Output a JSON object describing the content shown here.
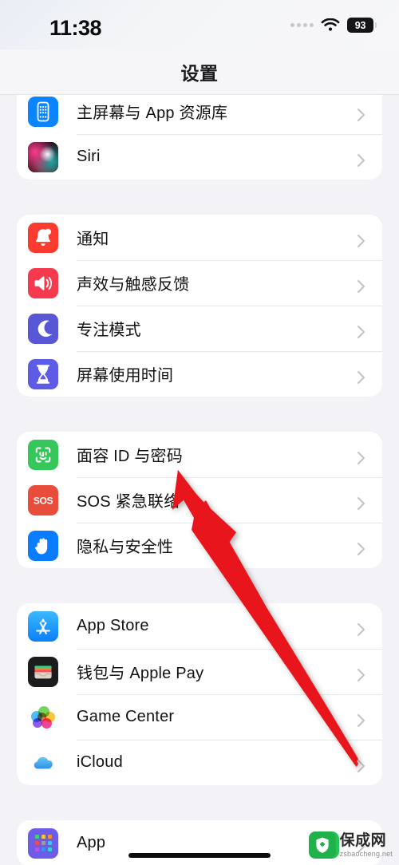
{
  "status_bar": {
    "time": "11:38",
    "signal_icon": "signal-dots-icon",
    "wifi_icon": "wifi-icon",
    "battery_level": "93",
    "battery_icon": "battery-icon"
  },
  "nav": {
    "title": "设置"
  },
  "colors": {
    "page_background": "#f2f2f7",
    "card_background": "#ffffff",
    "separator": "#e7e7ea",
    "chevron": "#c2c2c7",
    "label": "#121214",
    "arrow": "#e8161a",
    "battery_pill": "#151517"
  },
  "groups": [
    {
      "id": "group-personalization",
      "clipped_top": true,
      "rows": [
        {
          "id": "home-screen-app-library",
          "label": "主屏幕与 App 资源库",
          "icon": "home-screen-icon",
          "chevron": "chevron-right-icon"
        },
        {
          "id": "siri",
          "label": "Siri",
          "icon": "siri-icon",
          "chevron": "chevron-right-icon"
        }
      ]
    },
    {
      "id": "group-alerts",
      "clipped_top": false,
      "rows": [
        {
          "id": "notifications",
          "label": "通知",
          "icon": "bell-icon",
          "chevron": "chevron-right-icon"
        },
        {
          "id": "sounds-haptics",
          "label": "声效与触感反馈",
          "icon": "speaker-icon",
          "chevron": "chevron-right-icon"
        },
        {
          "id": "focus",
          "label": "专注模式",
          "icon": "moon-icon",
          "chevron": "chevron-right-icon"
        },
        {
          "id": "screen-time",
          "label": "屏幕使用时间",
          "icon": "hourglass-icon",
          "chevron": "chevron-right-icon"
        }
      ]
    },
    {
      "id": "group-security",
      "clipped_top": false,
      "rows": [
        {
          "id": "face-id-passcode",
          "label": "面容 ID 与密码",
          "icon": "face-id-icon",
          "chevron": "chevron-right-icon"
        },
        {
          "id": "emergency-sos",
          "label": "SOS 紧急联络",
          "icon": "sos-icon",
          "chevron": "chevron-right-icon"
        },
        {
          "id": "privacy-security",
          "label": "隐私与安全性",
          "icon": "hand-icon",
          "chevron": "chevron-right-icon"
        }
      ]
    },
    {
      "id": "group-services",
      "clipped_top": false,
      "rows": [
        {
          "id": "app-store",
          "label": "App Store",
          "icon": "app-store-icon",
          "chevron": "chevron-right-icon"
        },
        {
          "id": "wallet-apple-pay",
          "label": "钱包与 Apple Pay",
          "icon": "wallet-icon",
          "chevron": "chevron-right-icon"
        },
        {
          "id": "game-center",
          "label": "Game Center",
          "icon": "game-center-icon",
          "chevron": "chevron-right-icon"
        },
        {
          "id": "icloud",
          "label": "iCloud",
          "icon": "icloud-icon",
          "chevron": "chevron-right-icon"
        }
      ]
    },
    {
      "id": "group-apps",
      "clipped_top": false,
      "rows": [
        {
          "id": "app",
          "label": "App",
          "icon": "app-grid-icon",
          "chevron": "chevron-right-icon"
        }
      ]
    }
  ],
  "annotation": {
    "arrow_icon": "red-arrow-annotation",
    "points_to": "face-id-passcode"
  },
  "watermark": {
    "logo_icon": "shield-logo-icon",
    "name": "保成网",
    "url": "zsbaocheng.net"
  },
  "home_indicator": "home-indicator-bar"
}
